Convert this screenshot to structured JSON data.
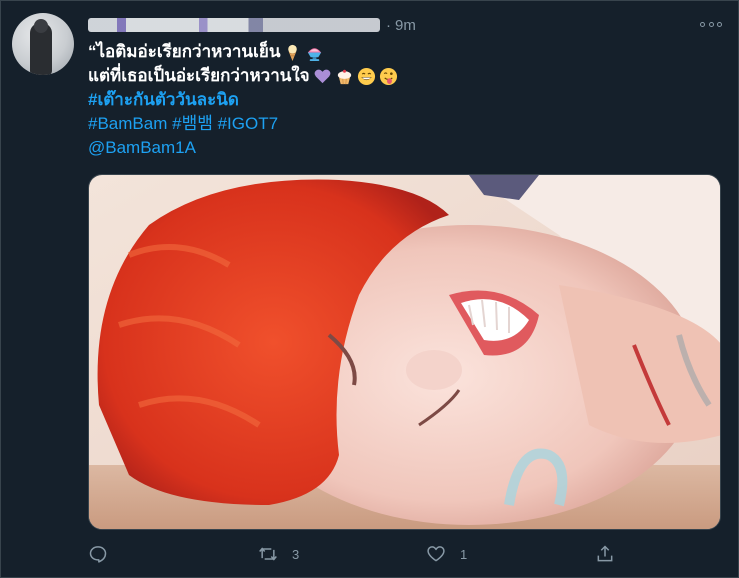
{
  "tweet": {
    "time": "9m",
    "separator": "·",
    "lines": {
      "line1": "“ไอติมอ่ะเรียกว่าหวานเย็น",
      "line2": "แต่ที่เธอเป็นอ่ะเรียกว่าหวานใจ"
    },
    "hashtag_thai": "#เต๊าะกันตัววันละนิด",
    "hashtags": [
      "#BamBam",
      "#뱀뱀",
      "#IGOT7"
    ],
    "mention": "@BamBam1A"
  },
  "line1_emojis": [
    "ice-cream-cone-icon",
    "shaved-ice-icon"
  ],
  "line2_emojis": [
    "purple-heart-icon",
    "cupcake-icon",
    "grinning-face-icon",
    "winking-tongue-face-icon"
  ],
  "actions": {
    "reply": {
      "icon": "reply-icon",
      "count": ""
    },
    "retweet": {
      "icon": "retweet-icon",
      "count": "3"
    },
    "like": {
      "icon": "heart-icon",
      "count": "1"
    },
    "share": {
      "icon": "share-icon",
      "count": ""
    }
  },
  "colors": {
    "background": "#15202b",
    "link": "#1da1f2",
    "muted": "#8899a6",
    "border": "#38444d"
  }
}
